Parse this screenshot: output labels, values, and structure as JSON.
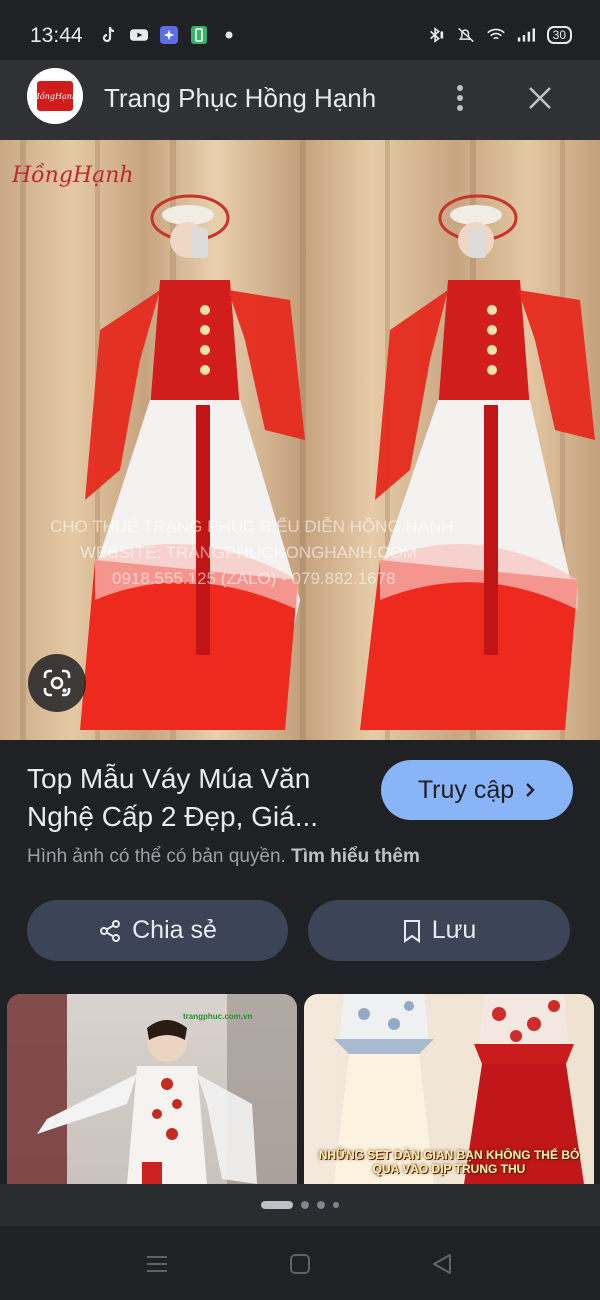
{
  "status": {
    "time": "13:44",
    "battery": "30",
    "icons_left": [
      "tiktok-icon",
      "youtube-icon",
      "app-icon",
      "battery-saver-icon",
      "dot-icon"
    ],
    "icons_right": [
      "bluetooth-icon",
      "mute-icon",
      "wifi-icon",
      "signal-icon",
      "battery-icon"
    ]
  },
  "header": {
    "favicon_text": "HồngHạnh",
    "site_name": "Trang Phục Hồng Hạnh",
    "more_icon": "more-vert-icon",
    "close_icon": "close-icon"
  },
  "hero": {
    "watermark_logo": "HồngHạnh",
    "watermark_line1": "CHO THUÊ TRANG PHỤC BIỂU DIỄN HỒNG HẠNH",
    "watermark_line2": "WEBSITE: TRANGPHUCHONGHANH.COM",
    "watermark_line3": "0918.555.125 (ZALO) - 079.882.1678",
    "lens_icon": "google-lens-icon"
  },
  "result": {
    "title": "Top Mẫu Váy Múa Văn Nghệ Cấp 2 Đẹp, Giá...",
    "visit_label": "Truy cập",
    "copyright_text": "Hình ảnh có thể có bản quyền.",
    "learn_more": "Tìm hiểu thêm"
  },
  "actions": {
    "share_label": "Chia sẻ",
    "save_label": "Lưu"
  },
  "related": {
    "item2_caption": "NHỮNG SET DÂN GIAN BẠN KHÔNG THỂ BỎ QUA VÀO DỊP TRUNG THU",
    "item1_overlay": "trangphuc.com.vn"
  },
  "pager": {
    "count": 4,
    "active": 0
  },
  "nav": {
    "icons": [
      "recents-icon",
      "home-icon",
      "back-icon"
    ]
  }
}
